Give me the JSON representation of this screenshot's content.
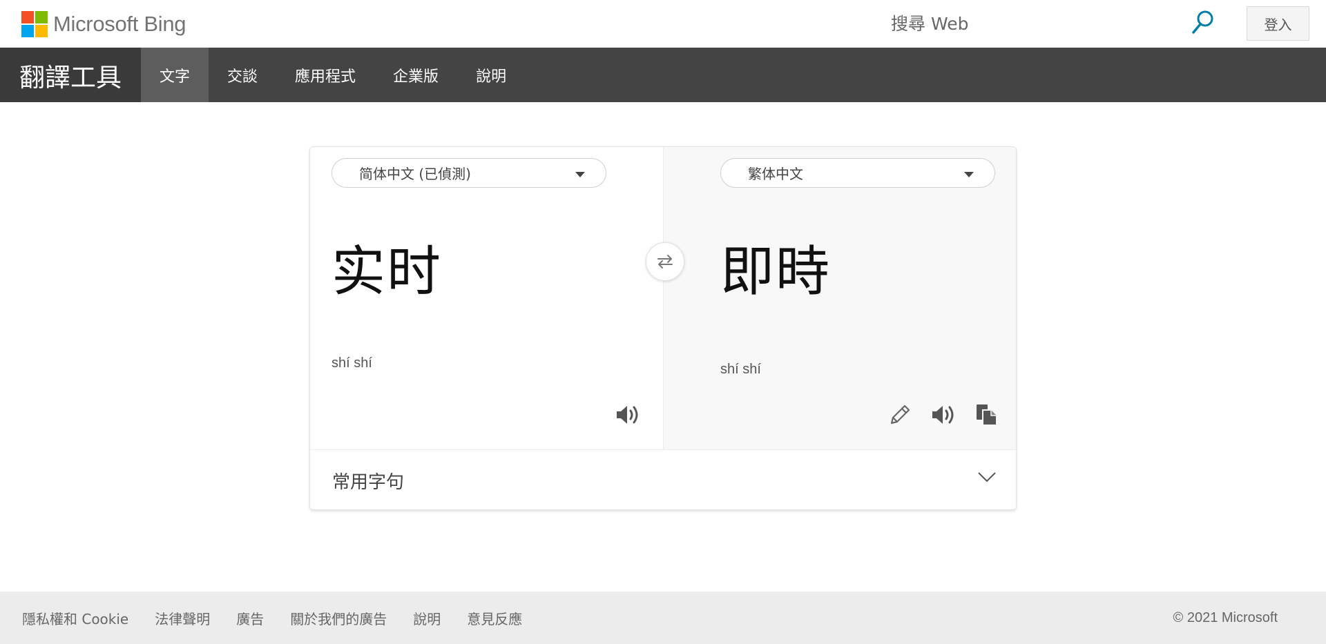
{
  "header": {
    "logo_text": "Microsoft Bing",
    "logo_colors": [
      "#f25022",
      "#7fba00",
      "#00a4ef",
      "#ffb900"
    ],
    "search_placeholder": "搜尋 Web",
    "search_icon": "search-icon",
    "search_icon_color": "#007daa",
    "signin_label": "登入"
  },
  "nav": {
    "brand": "翻譯工具",
    "items": [
      {
        "label": "文字",
        "active": true
      },
      {
        "label": "交談",
        "active": false
      },
      {
        "label": "應用程式",
        "active": false
      },
      {
        "label": "企業版",
        "active": false
      },
      {
        "label": "說明",
        "active": false
      }
    ],
    "background": "#444444"
  },
  "translator": {
    "source": {
      "language": "简体中文 (已偵測)",
      "text": "实时",
      "transliteration": "shí shí",
      "speaker_icon": "speaker-icon"
    },
    "target": {
      "language": "繁体中文",
      "text": "即時",
      "transliteration": "shí shí",
      "icons": [
        "pencil-icon",
        "speaker-icon",
        "copy-icon"
      ]
    },
    "swap_icon": "swap-icon",
    "phrases_label": "常用字句",
    "phrases_icon": "chevron-down-icon"
  },
  "footer": {
    "links": [
      "隱私權和 Cookie",
      "法律聲明",
      "廣告",
      "關於我們的廣告",
      "說明",
      "意見反應"
    ],
    "copyright": "© 2021 Microsoft"
  }
}
